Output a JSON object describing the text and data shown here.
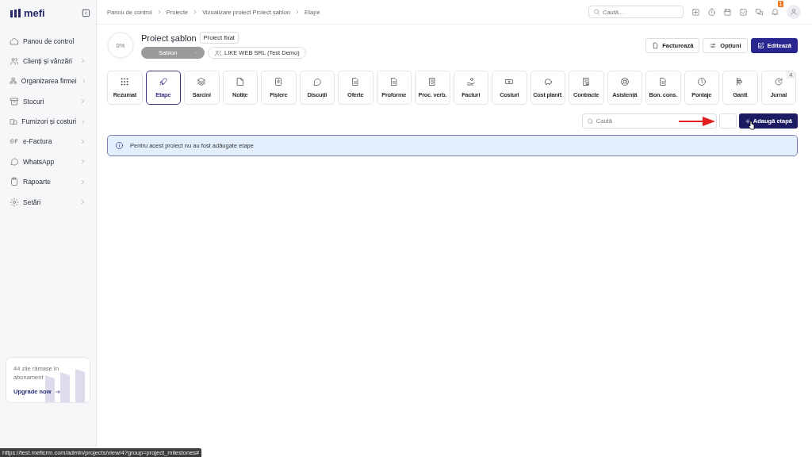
{
  "sidebar": {
    "logo": "mefi",
    "items": [
      {
        "label": "Panou de control",
        "expandable": false
      },
      {
        "label": "Clienți și vânzări",
        "expandable": true
      },
      {
        "label": "Organizarea firmei",
        "expandable": true
      },
      {
        "label": "Stocuri",
        "expandable": true
      },
      {
        "label": "Furnizori și costuri",
        "expandable": true
      },
      {
        "label": "e-Factura",
        "expandable": true
      },
      {
        "label": "WhatsApp",
        "expandable": true
      },
      {
        "label": "Rapoarte",
        "expandable": true
      },
      {
        "label": "Setări",
        "expandable": true
      }
    ],
    "promo": {
      "text": "44 zile rămase în abonament",
      "link": "Upgrade now"
    }
  },
  "breadcrumbs": [
    "Panou de control",
    "Proiecte",
    "Vizualizare proiect Proiect șablon",
    "Etape"
  ],
  "search": {
    "placeholder": "Caută..."
  },
  "notifications": {
    "badge": "1"
  },
  "project": {
    "progress": "0%",
    "title": "Proiect șablon",
    "type": "Proiect fixat",
    "status": "Șablon",
    "client": "LIKE WEB SRL (Test Demo)"
  },
  "actions": [
    {
      "label": "Facturează",
      "kind": "plain"
    },
    {
      "label": "Opțiuni",
      "kind": "plain"
    },
    {
      "label": "Editează",
      "kind": "primary"
    }
  ],
  "tabs": [
    {
      "label": "Rezumat",
      "selected": false
    },
    {
      "label": "Etape",
      "selected": true
    },
    {
      "label": "Sarcini",
      "selected": false
    },
    {
      "label": "Notițe",
      "selected": false
    },
    {
      "label": "Fișiere",
      "selected": false
    },
    {
      "label": "Discuții",
      "selected": false
    },
    {
      "label": "Oferte",
      "selected": false
    },
    {
      "label": "Proforme",
      "selected": false
    },
    {
      "label": "Proc. verb.",
      "selected": false
    },
    {
      "label": "Facturi",
      "selected": false
    },
    {
      "label": "Costuri",
      "selected": false
    },
    {
      "label": "Cost planif.",
      "selected": false
    },
    {
      "label": "Contracte",
      "selected": false
    },
    {
      "label": "Asistență",
      "selected": false
    },
    {
      "label": "Bon. cons.",
      "selected": false
    },
    {
      "label": "Pontaje",
      "selected": false
    },
    {
      "label": "Gantt",
      "selected": false
    },
    {
      "label": "Jurnal",
      "selected": false,
      "count": "4"
    }
  ],
  "toolbar": {
    "placeholder": "Caută",
    "add_button": "Adaugă etapă"
  },
  "alert": "Pentru acest proiect nu au fost adăugate etape",
  "status_bar": "https://test.meficrm.com/admin/projects/view/4?group=project_milestones#"
}
